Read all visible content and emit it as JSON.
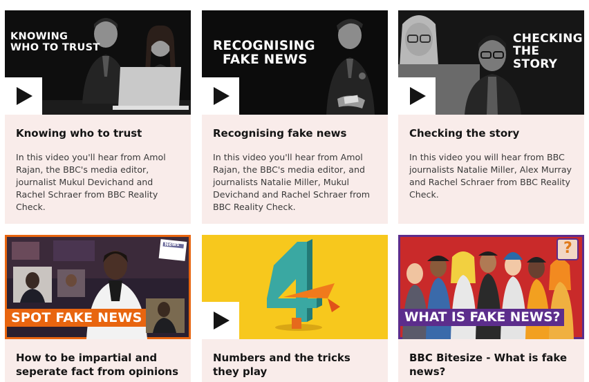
{
  "cards": [
    {
      "thumb_text_line1": "Knowing",
      "thumb_text_line2": "who to trust",
      "title": "Knowing who to trust",
      "description": "In this video you'll hear from Amol Rajan, the BBC's media editor, journalist Mukul Devichand and Rachel Schraer from BBC Reality Check.",
      "has_play": true
    },
    {
      "thumb_text_line1": "Recognising",
      "thumb_text_line2": "fake news",
      "title": "Recognising fake news",
      "description": "In this video you'll hear from Amol Rajan, the BBC's media editor, and journalists Natalie Miller, Mukul Devichand and Rachel Schraer from BBC Reality Check.",
      "has_play": true
    },
    {
      "thumb_text_line1": "Checking",
      "thumb_text_line2": "the story",
      "title": "Checking the story",
      "description": "In this video you will hear from BBC journalists Natalie Miller, Alex Murray and Rachel Schraer from BBC Reality Check.",
      "has_play": true
    },
    {
      "thumb_banner": "Spot fake news",
      "thumb_badge": "News",
      "title": "How to be impartial and seperate fact from opinions",
      "has_play": false
    },
    {
      "title": "Numbers and the tricks they play",
      "has_play": true
    },
    {
      "thumb_banner": "What is fake news?",
      "thumb_badge": "?",
      "title": "BBC Bitesize - What is fake news?",
      "has_play": false
    }
  ],
  "icons": {
    "play": "play-icon"
  },
  "colors": {
    "card_bg": "#f9ecea",
    "spot_banner": "#e8650f",
    "what_banner": "#5c2d8c",
    "numbers_bg": "#f7c81d"
  }
}
